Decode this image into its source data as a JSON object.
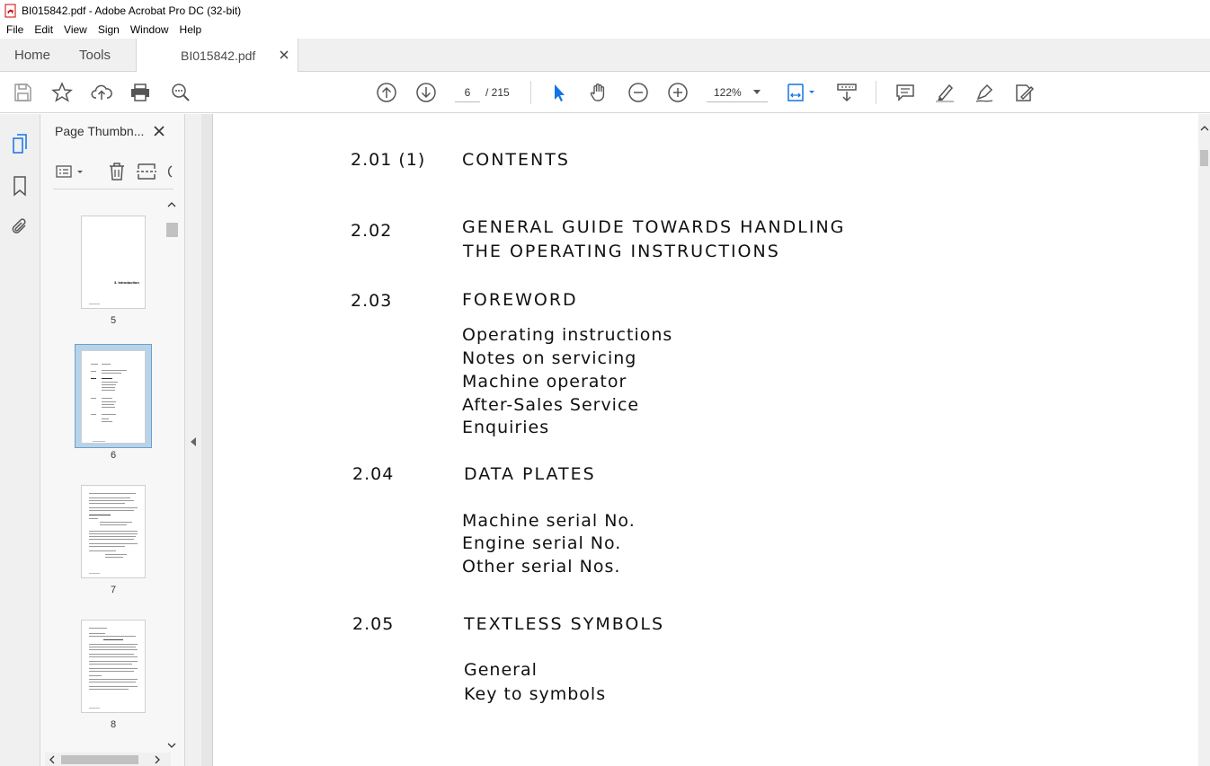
{
  "window": {
    "title": "BI015842.pdf - Adobe Acrobat Pro DC (32-bit)"
  },
  "menu": {
    "items": [
      "File",
      "Edit",
      "View",
      "Sign",
      "Window",
      "Help"
    ]
  },
  "tabs": {
    "home": "Home",
    "tools": "Tools",
    "document": "BI015842.pdf"
  },
  "toolbar": {
    "current_page": "6",
    "page_total": "/ 215",
    "zoom": "122%"
  },
  "thumbnail_panel": {
    "title": "Page Thumbn...",
    "thumbnails": [
      {
        "page": "5",
        "caption_text": "3. Introduction"
      },
      {
        "page": "6",
        "selected": true
      },
      {
        "page": "7"
      },
      {
        "page": "8"
      }
    ]
  },
  "document": {
    "entries": [
      {
        "num": "2.01 (1)",
        "lines": [
          "CONTENTS"
        ]
      },
      {
        "num": "2.02",
        "lines": [
          "GENERAL GUIDE TOWARDS HANDLING",
          "THE OPERATING INSTRUCTIONS"
        ]
      },
      {
        "num": "2.03",
        "lines": [
          "FOREWORD"
        ],
        "sub": [
          "Operating instructions",
          "Notes on servicing",
          "Machine operator",
          "After-Sales Service",
          "Enquiries"
        ]
      },
      {
        "num": "2.04",
        "lines": [
          "DATA PLATES"
        ],
        "sub": [
          "Machine serial No.",
          "Engine serial No.",
          "Other serial Nos."
        ]
      },
      {
        "num": "2.05",
        "lines": [
          "TEXTLESS SYMBOLS"
        ],
        "sub": [
          "General",
          "Key to symbols"
        ]
      }
    ]
  }
}
